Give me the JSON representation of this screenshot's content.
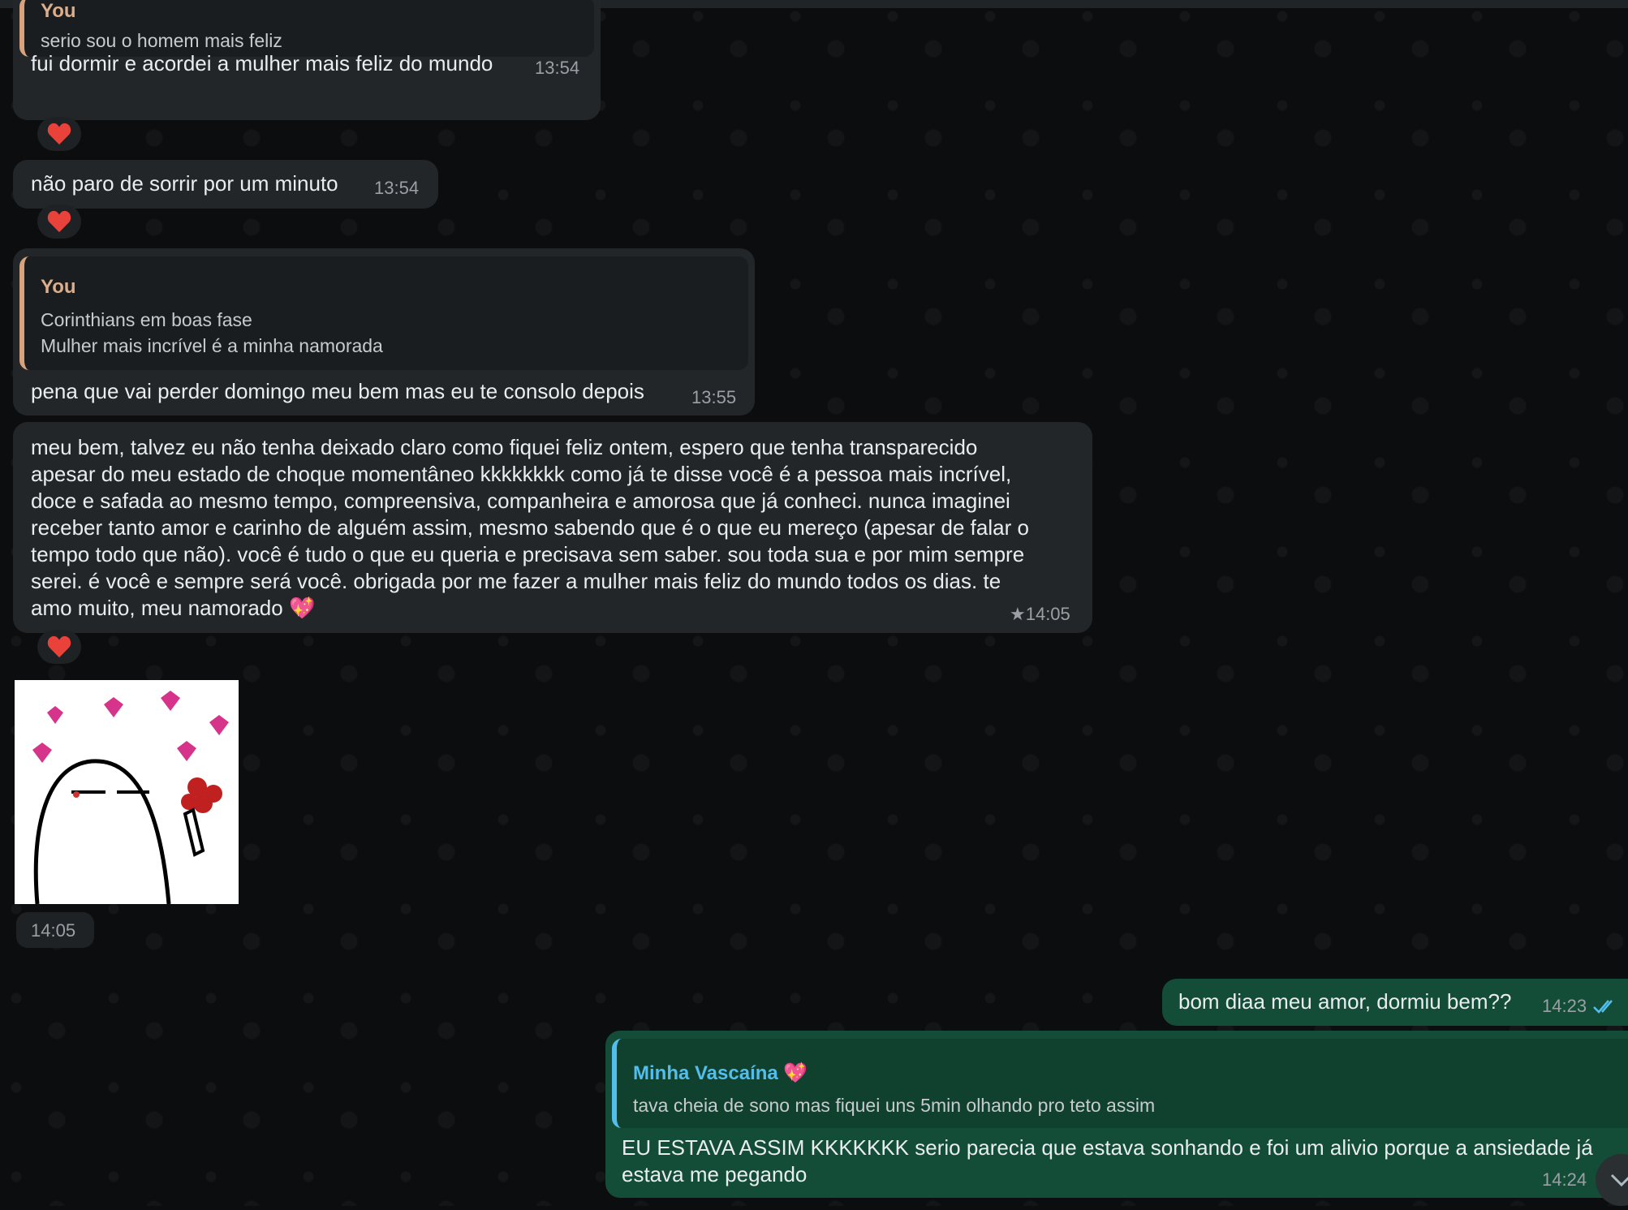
{
  "messages": {
    "m1": {
      "quote_author": "You",
      "quote_text": "serio sou o homem mais feliz",
      "text": "fui dormir e acordei a mulher mais feliz do mundo",
      "time": "13:54"
    },
    "m2": {
      "text": "não paro de sorrir por um minuto",
      "time": "13:54"
    },
    "m3": {
      "quote_author": "You",
      "quote_text": "Corinthians em boas fase\nMulher mais incrível é a minha namorada",
      "text": "pena que vai perder domingo meu bem mas eu te consolo depois",
      "time": "13:55"
    },
    "m4": {
      "text": "meu bem, talvez eu não tenha deixado claro como fiquei feliz ontem, espero que tenha transparecido\napesar do meu estado de choque momentâneo kkkkkkkk como já te disse você é a pessoa mais incrível,\ndoce e safada ao mesmo tempo, compreensiva, companheira e amorosa que já conheci. nunca imaginei\nreceber tanto amor e carinho de alguém assim, mesmo sabendo que é o que eu mereço (apesar de falar o\ntempo todo que não). você é tudo o que eu queria e precisava sem saber. sou toda sua e por mim sempre\nserei. é você e sempre será você. obrigada por me fazer a mulher mais feliz do mundo todos os dias. te\namo muito, meu namorado",
      "emoji": "💖",
      "time": "★14:05"
    },
    "sticker": {
      "time": "14:05"
    },
    "m5": {
      "text": "bom diaa meu amor, dormiu bem??",
      "time": "14:23"
    },
    "m6": {
      "quote_author": "Minha Vascaína 💖",
      "quote_text": "tava cheia de sono mas fiquei uns 5min olhando pro teto assim",
      "text": "EU ESTAVA ASSIM KKKKKKK serio parecia que estava sonhando e foi um alivio porque a ansiedade já\nestava me pegando",
      "time": "14:24"
    }
  },
  "reactions": {
    "emoji": "❤️"
  },
  "colors": {
    "incoming_bubble": "#232628",
    "outgoing_bubble": "#144d37",
    "quote_accent_incoming": "#d8a27c",
    "quote_accent_outgoing": "#53bdeb",
    "heart": "#e8423b",
    "read_ticks": "#53bdeb"
  },
  "icons": {
    "reaction": "heart-icon",
    "read_receipt": "double-check-icon",
    "scroll": "chevron-down-icon"
  }
}
